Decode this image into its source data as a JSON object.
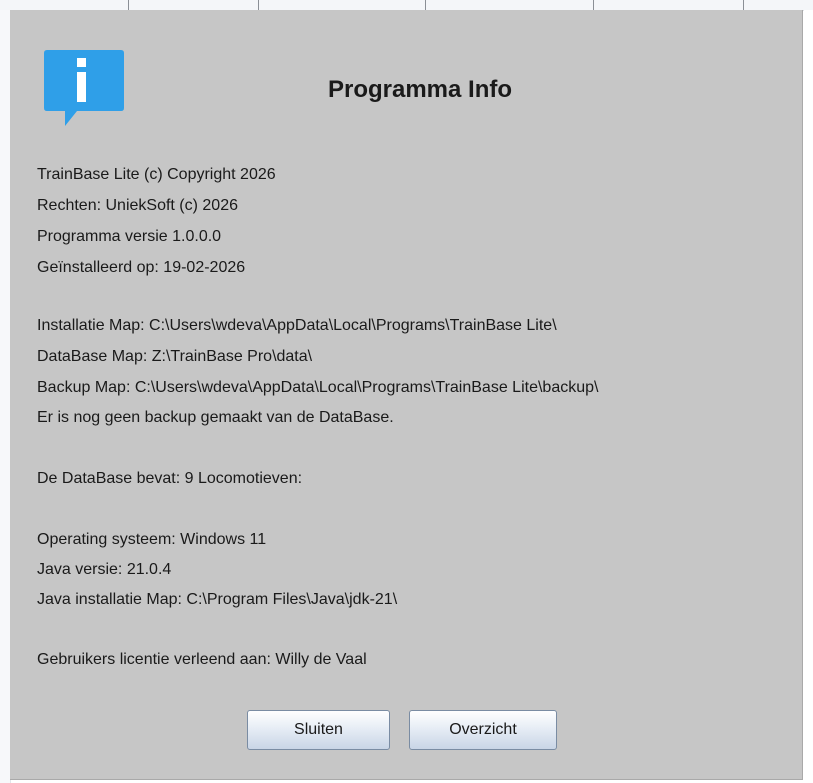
{
  "dialog": {
    "title": "Programma Info",
    "icon": "info-icon",
    "lines": [
      "TrainBase Lite (c) Copyright 2026",
      "Rechten: UniekSoft (c) 2026",
      "Programma versie 1.0.0.0",
      "Geïnstalleerd op: 19-02-2026",
      "Installatie Map: C:\\Users\\wdeva\\AppData\\Local\\Programs\\TrainBase Lite\\",
      "DataBase Map: Z:\\TrainBase Pro\\data\\",
      "Backup Map: C:\\Users\\wdeva\\AppData\\Local\\Programs\\TrainBase Lite\\backup\\",
      "Er is nog geen backup gemaakt van de DataBase.",
      "De DataBase bevat: 9 Locomotieven:",
      "Operating systeem: Windows 11",
      "Java versie: 21.0.4",
      "Java installatie Map: C:\\Program Files\\Java\\jdk-21\\",
      "Gebruikers licentie verleend aan: Willy de Vaal"
    ],
    "buttons": {
      "close": "Sluiten",
      "overview": "Overzicht"
    }
  },
  "colors": {
    "dialog_background": "#c6c6c6",
    "icon_blue": "#2f9fe8",
    "text": "#1a1a1a"
  }
}
